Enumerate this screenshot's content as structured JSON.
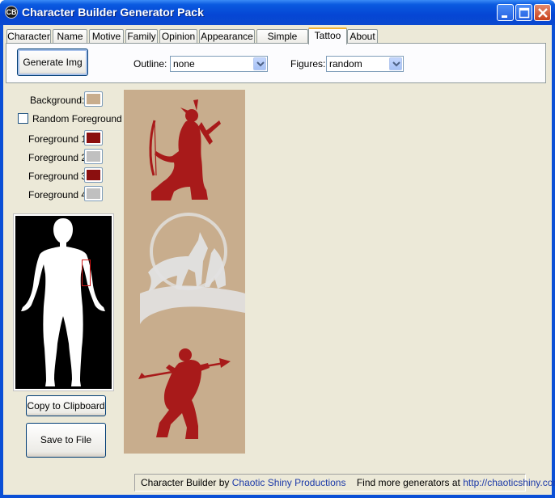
{
  "window": {
    "title": "Character Builder Generator Pack",
    "app_icon_glyph": "CB"
  },
  "tabs": [
    {
      "label": "Character",
      "active": false
    },
    {
      "label": "Name",
      "active": false
    },
    {
      "label": "Motive",
      "active": false
    },
    {
      "label": "Family",
      "active": false
    },
    {
      "label": "Opinion",
      "active": false
    },
    {
      "label": "Appearance",
      "active": false
    },
    {
      "label": "Simple Char",
      "active": false
    },
    {
      "label": "Tattoo",
      "active": true
    },
    {
      "label": "About",
      "active": false
    }
  ],
  "toolbar": {
    "generate_label": "Generate Img",
    "outline_label": "Outline:",
    "outline_value": "none",
    "figures_label": "Figures:",
    "figures_value": "random"
  },
  "colors_panel": {
    "background_label": "Background:",
    "background_color": "#c8ad8d",
    "random_fg_label": "Random Foreground",
    "random_fg_checked": false,
    "fg1_label": "Foreground 1:",
    "fg1_color": "#8b0f0f",
    "fg2_label": "Foreground 2:",
    "fg2_color": "#c0c0c0",
    "fg3_label": "Foreground 3:",
    "fg3_color": "#8b0f0f",
    "fg4_label": "Foreground 4:",
    "fg4_color": "#c0c0c0"
  },
  "buttons": {
    "copy_label": "Copy to Clipboard",
    "save_label": "Save to File"
  },
  "tattoo_figures": [
    {
      "name": "kneeling-archer",
      "color": "#a81a1a"
    },
    {
      "name": "howling-wolves-moon",
      "color": "#e2e2e2"
    },
    {
      "name": "spear-warrior",
      "color": "#a81a1a"
    }
  ],
  "status": {
    "prefix": "Character Builder by",
    "company": "Chaotic Shiny Productions",
    "middle": "Find more generators at",
    "url": "http://chaoticshiny.com/"
  }
}
